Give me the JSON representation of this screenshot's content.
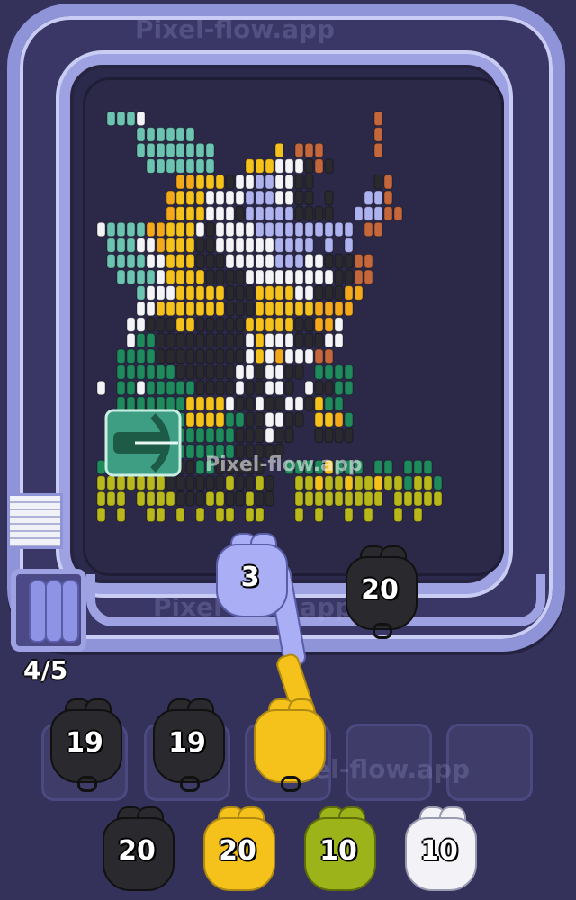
{
  "watermark": "Pixel-flow.app",
  "counter": "4/5",
  "active_shooter": {
    "count": "3",
    "color": "#a9aef5"
  },
  "queue_on_track": [
    {
      "count": "20",
      "color": "#2a2a2e"
    }
  ],
  "slots_row": [
    {
      "count": "19",
      "color": "#2a2a2e",
      "filled": true
    },
    {
      "count": "19",
      "color": "#2a2a2e",
      "filled": true
    },
    {
      "count": "",
      "color": "#f9c21a",
      "filled": true
    },
    {
      "count": "",
      "filled": false
    },
    {
      "count": "",
      "filled": false
    }
  ],
  "bench_row": [
    {
      "count": "20",
      "color": "#2a2a2e"
    },
    {
      "count": "20",
      "color": "#f9c21a"
    },
    {
      "count": "10",
      "color": "#9db31a"
    },
    {
      "count": "10",
      "color": "#f3f3f7"
    }
  ],
  "palette": {
    "teal": "#6cc4b0",
    "green": "#1f8a5c",
    "yellow": "#f5c21b",
    "orange": "#f3a91a",
    "white": "#f4f4f6",
    "lavender": "#aeb2ef",
    "black": "#2a2a2e",
    "brown": "#c4673a",
    "olive": "#b8b81a"
  }
}
